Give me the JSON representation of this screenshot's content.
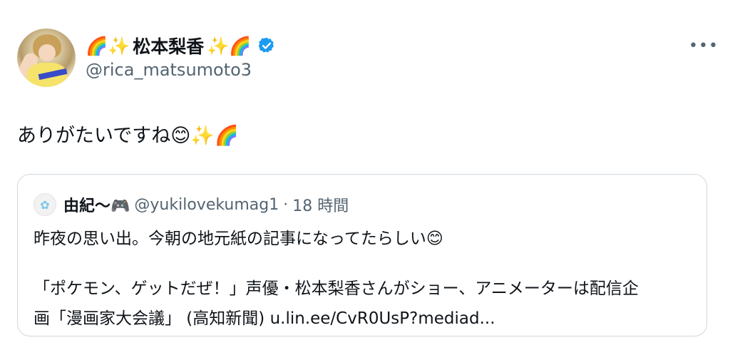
{
  "author": {
    "name_prefix_emoji": "🌈✨",
    "name": "松本梨香",
    "name_suffix_emoji": "✨🌈",
    "handle": "@rica_matsumoto3"
  },
  "tweet": {
    "text": "ありがたいですね😊✨🌈"
  },
  "quoted": {
    "author_name": "由紀〜🎮",
    "handle": "@yukilovekumag1",
    "separator": "·",
    "time": "18 時間",
    "lines": [
      "昨夜の思い出。今朝の地元紙の記事になってたらしい😊",
      "「ポケモン、ゲットだぜ！」声優・松本梨香さんがショー、アニメーターは配信企",
      "画「漫画家大会議」 (高知新聞) u.lin.ee/CvR0UsP?mediad..."
    ]
  },
  "icons": {
    "verified": "verified-badge-icon",
    "more": "more-options-icon"
  },
  "colors": {
    "text": "#0f1419",
    "secondary": "#536471",
    "verified": "#1d9bf0",
    "border": "#cfd9de"
  }
}
